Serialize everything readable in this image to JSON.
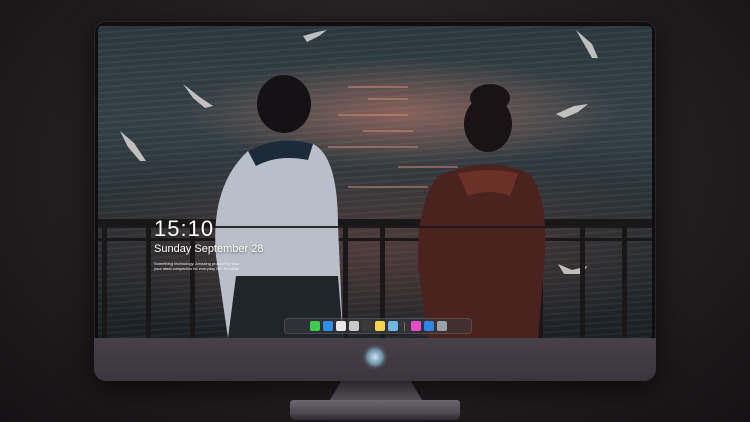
{
  "lockscreen": {
    "time": "15:10",
    "date": "Sunday September 28",
    "quote_line1": "Something technology. Amazing product by Mac",
    "quote_line2": "your ideal companion for everyday life. Beautiful"
  },
  "dock": {
    "apps": [
      {
        "name": "messages-icon",
        "color": "#3ecf4a"
      },
      {
        "name": "finder-icon",
        "color": "#2f8fe8"
      },
      {
        "name": "safari-icon",
        "color": "#e8e8e8"
      },
      {
        "name": "notes-app-icon",
        "color": "#c9c9c9"
      },
      {
        "name": "clapper-icon",
        "color": "#3a3a3a"
      },
      {
        "name": "stickies-icon",
        "color": "#f2d34a"
      },
      {
        "name": "preview-icon",
        "color": "#6bb8e8"
      },
      {
        "name": "itunes-icon",
        "color": "#e84cc8"
      },
      {
        "name": "app-store-icon",
        "color": "#2e86e6"
      },
      {
        "name": "screenshot-icon",
        "color": "#9aa3ab"
      }
    ]
  }
}
